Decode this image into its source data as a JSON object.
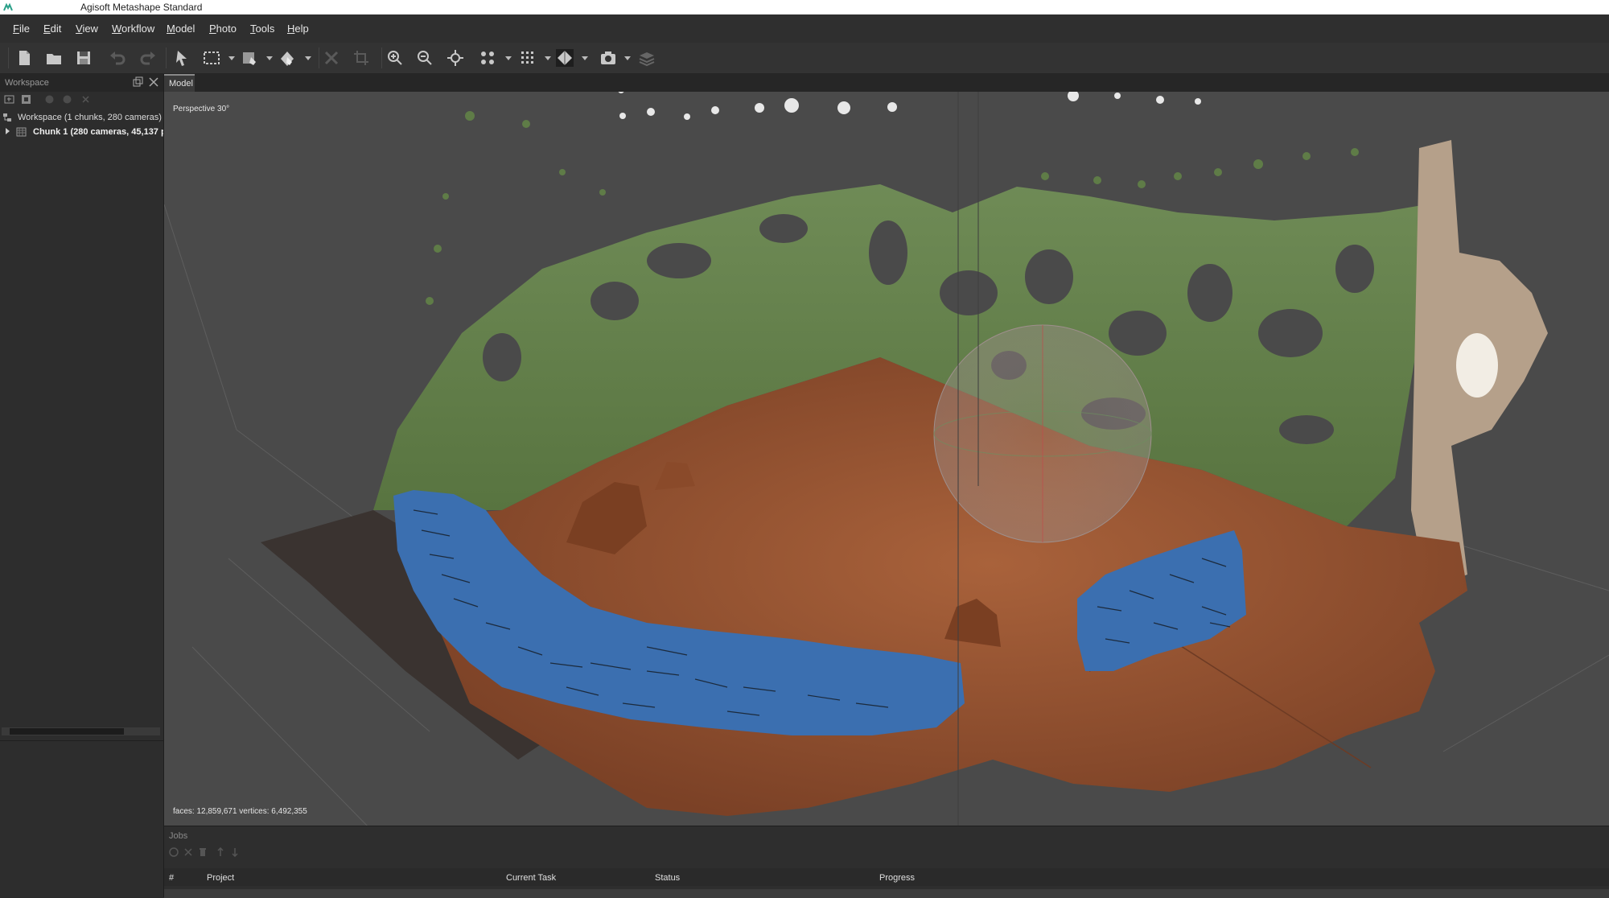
{
  "window": {
    "title": "Agisoft Metashape Standard"
  },
  "menu": [
    "File",
    "Edit",
    "View",
    "Workflow",
    "Model",
    "Photo",
    "Tools",
    "Help"
  ],
  "toolbar": {
    "icons": [
      "new-icon",
      "open-icon",
      "save-icon",
      "undo-icon",
      "redo-icon",
      "pointer-icon",
      "rect-select-icon",
      "paint-select-icon",
      "shape-icon",
      "delete-icon",
      "crop-icon",
      "zoom-in-icon",
      "zoom-out-icon",
      "reset-view-icon",
      "show-points-icon",
      "show-grid-icon",
      "show-model-icon",
      "capture-icon",
      "layers-icon"
    ]
  },
  "workspace": {
    "panel_title": "Workspace",
    "root_label": "Workspace (1 chunks, 280 cameras)",
    "chunk_label": "Chunk 1 (280 cameras, 45,137 p"
  },
  "viewport": {
    "tab_label": "Model",
    "view_mode": "Perspective 30°",
    "stats": "faces: 12,859,671 vertices: 6,492,355"
  },
  "jobs": {
    "title": "Jobs",
    "columns": [
      "#",
      "Project",
      "Current Task",
      "Status",
      "Progress"
    ]
  },
  "colors": {
    "camera_blue": "#3b6fb0",
    "wall_green": "#5d7a44",
    "terrain_brown": "#8d4e2c",
    "background": "#4a4a4a"
  }
}
